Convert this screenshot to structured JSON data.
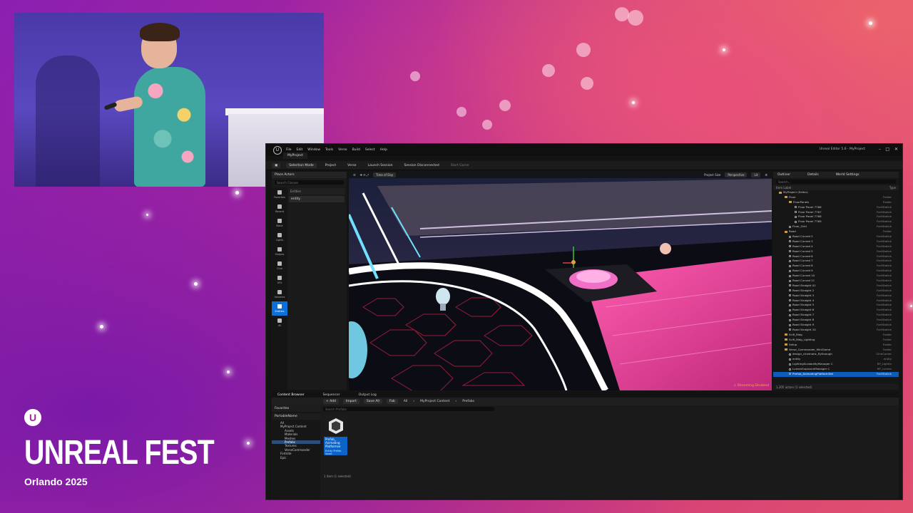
{
  "event": {
    "title": "UNREAL FEST",
    "subtitle": "Orlando 2025",
    "logo_icon": "unreal-engine-logo"
  },
  "editor": {
    "window_title": "Unreal Editor 5.6 - MyProject",
    "project_tab": "MyProject",
    "menu": [
      "File",
      "Edit",
      "Window",
      "Tools",
      "Verse",
      "Build",
      "Select",
      "Help"
    ],
    "toolbar": {
      "selection_mode": "Selection Mode",
      "project": "Project",
      "verse": "Verse",
      "launch_session": "Launch Session",
      "session_status": "Session Disconnected",
      "start_game": "Start Game"
    },
    "place_actors": {
      "title": "Place Actors",
      "search_placeholder": "Search Classes",
      "categories": [
        "Favorites",
        "Recent",
        "Basic",
        "Lights",
        "Shapes",
        "Cine",
        "VFX",
        "Volumes",
        "Entities",
        "All"
      ],
      "list_header": "Entities",
      "items": [
        "entity"
      ]
    },
    "viewport": {
      "time_of_day": "Time of Day",
      "project_size": "Project Size",
      "perspective": "Perspective",
      "lit": "Lit",
      "streaming_status": "Streaming Disabled"
    },
    "outliner": {
      "tabs": [
        "Outliner",
        "Details",
        "World Settings"
      ],
      "search_placeholder": "Search...",
      "col_label": "Item Label",
      "col_type": "Type",
      "rows": [
        {
          "name": "MyProject (Editor)",
          "type": "",
          "kind": "folder"
        },
        {
          "name": "Floor",
          "type": "Folder",
          "kind": "folder"
        },
        {
          "name": "FloorPanels",
          "type": "Folder",
          "kind": "folder"
        },
        {
          "name": "Floor Panel 7766",
          "type": "FortStatick",
          "kind": "mesh"
        },
        {
          "name": "Floor Panel 7767",
          "type": "FortStatick",
          "kind": "mesh"
        },
        {
          "name": "Floor Panel 7768",
          "type": "FortStatick",
          "kind": "mesh"
        },
        {
          "name": "Floor Panel 7769",
          "type": "FortStatick",
          "kind": "mesh"
        },
        {
          "name": "Floor_Grid",
          "type": "FortStatick",
          "kind": "mesh"
        },
        {
          "name": "Road",
          "type": "Folder",
          "kind": "folder"
        },
        {
          "name": "Road Curved 2",
          "type": "FortStatick",
          "kind": "mesh"
        },
        {
          "name": "Road Curved 3",
          "type": "FortStatick",
          "kind": "mesh"
        },
        {
          "name": "Road Curved 4",
          "type": "FortStatick",
          "kind": "mesh"
        },
        {
          "name": "Road Curved 5",
          "type": "FortStatick",
          "kind": "mesh"
        },
        {
          "name": "Road Curved 6",
          "type": "FortStatick",
          "kind": "mesh"
        },
        {
          "name": "Road Curved 7",
          "type": "FortStatick",
          "kind": "mesh"
        },
        {
          "name": "Road Curved 8",
          "type": "FortStatick",
          "kind": "mesh"
        },
        {
          "name": "Road Curved 9",
          "type": "FortStatick",
          "kind": "mesh"
        },
        {
          "name": "Road Curved 10",
          "type": "FortStatick",
          "kind": "mesh"
        },
        {
          "name": "Road Curved 11",
          "type": "FortStatick",
          "kind": "mesh"
        },
        {
          "name": "Road Straight 01",
          "type": "FortStatick",
          "kind": "mesh"
        },
        {
          "name": "Road Straight 2",
          "type": "FortStatick",
          "kind": "mesh"
        },
        {
          "name": "Road Straight 3",
          "type": "FortStatick",
          "kind": "mesh"
        },
        {
          "name": "Road Straight 4",
          "type": "FortStatick",
          "kind": "mesh"
        },
        {
          "name": "Road Straight 5",
          "type": "FortStatick",
          "kind": "mesh"
        },
        {
          "name": "Road Straight 6",
          "type": "FortStatick",
          "kind": "mesh"
        },
        {
          "name": "Road Straight 7",
          "type": "FortStatick",
          "kind": "mesh"
        },
        {
          "name": "Road Straight 8",
          "type": "FortStatick",
          "kind": "mesh"
        },
        {
          "name": "Road Straight 9",
          "type": "FortStatick",
          "kind": "mesh"
        },
        {
          "name": "Road Straight 10",
          "type": "FortStatick",
          "kind": "mesh"
        },
        {
          "name": "Scifi_Bldg",
          "type": "Folder",
          "kind": "folder"
        },
        {
          "name": "Scifi_Bldg_Lighting",
          "type": "Folder",
          "kind": "folder"
        },
        {
          "name": "Setup",
          "type": "Folder",
          "kind": "folder"
        },
        {
          "name": "Verse_Commander_MiniGame",
          "type": "Folder",
          "kind": "folder"
        },
        {
          "name": "design_cinematic_flythrough",
          "type": "CineCamer",
          "kind": "mesh"
        },
        {
          "name": "entity",
          "type": "entity",
          "kind": "mesh"
        },
        {
          "name": "LightingScalabilityManager C",
          "type": "BP_Lightin",
          "kind": "mesh"
        },
        {
          "name": "LumenExposureManager C",
          "type": "BP_Lumen",
          "kind": "mesh"
        },
        {
          "name": "Prefab_AnimatingPlatformSet",
          "type": "FortStatick",
          "kind": "mesh",
          "selected": true
        }
      ],
      "footer": "1,305 actors (1 selected)"
    },
    "bottom_panel": {
      "tabs": [
        "Content Browser",
        "Sequencer",
        "Output Log"
      ],
      "add": "Add",
      "import": "Import",
      "save_all": "Save All",
      "fab": "Fab",
      "breadcrumb": [
        "All",
        "MyProject Content",
        "Prefabs"
      ],
      "search_placeholder": "Search Prefabs",
      "favorites": "Favorites",
      "project_section": "PortableName",
      "tree": [
        "All",
        "MyProject Content",
        "Assets",
        "Materials",
        "Meshes",
        "Prefabs",
        "Textures",
        "VerseCommander",
        "Fortnite",
        "Epic"
      ],
      "asset": {
        "name": "Prefab_ Animating Platformse",
        "type": "Entity Prefab Asset"
      },
      "status": "1 item (1 selected)"
    }
  },
  "colors": {
    "accent_blue": "#0d6fd8",
    "streaming_warning": "#e8b440",
    "background_pink": "#d23a7c",
    "background_purple": "#8a1fb0"
  }
}
